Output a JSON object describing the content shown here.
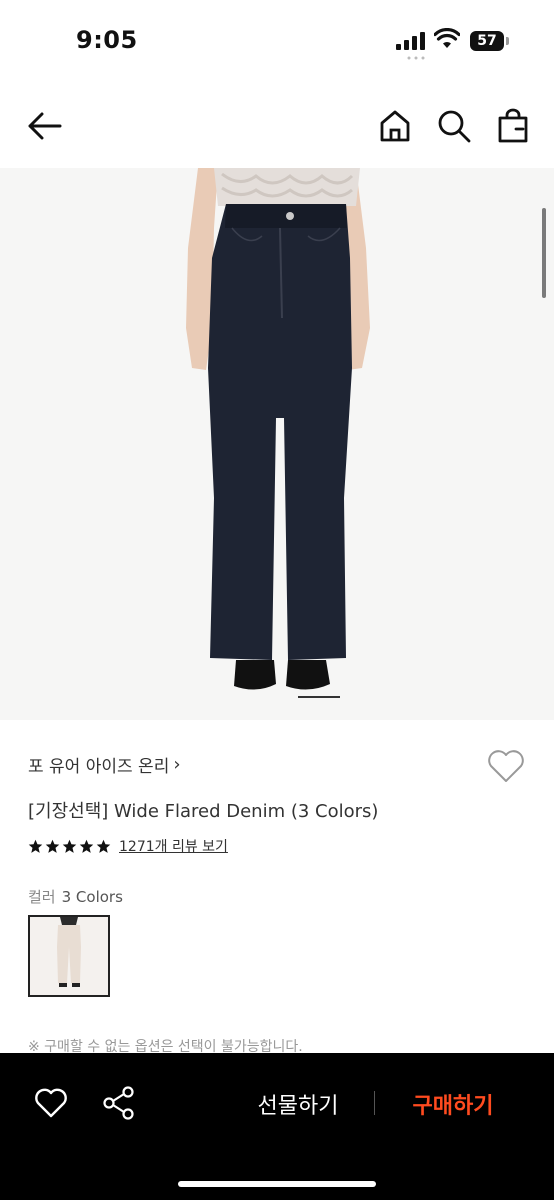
{
  "status_bar": {
    "time": "9:05",
    "battery": "57",
    "icons": [
      "signal-icon",
      "wifi-icon",
      "battery-icon"
    ]
  },
  "header": {
    "icons": [
      "back-arrow-icon",
      "home-icon",
      "search-icon",
      "shopping-bag-icon"
    ]
  },
  "product": {
    "brand": "포 유어 아이즈 온리",
    "brand_chevron": "›",
    "title": "[기장선택] Wide Flared Denim (3 Colors)",
    "rating": 5,
    "review_link": "1271개 리뷰 보기",
    "color_label": "컬러",
    "color_value": "3 Colors",
    "notice": "※ 구매할 수 없는 옵션은 선택이 불가능합니다."
  },
  "bottom_bar": {
    "gift_label": "선물하기",
    "buy_label": "구매하기",
    "buy_color": "#ff4b1f",
    "icons": [
      "heart-icon",
      "share-icon"
    ]
  }
}
